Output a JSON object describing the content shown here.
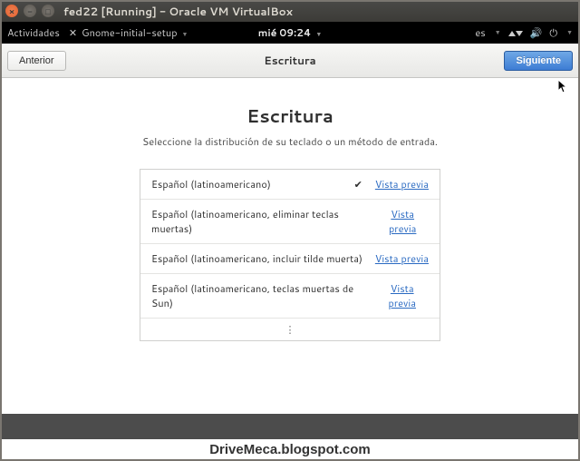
{
  "vm": {
    "title": "fed22 [Running] - Oracle VM VirtualBox"
  },
  "topbar": {
    "activities": "Actividades",
    "app": "Gnome-initial-setup",
    "clock": "mié 09:24",
    "lang": "es"
  },
  "headerbar": {
    "back": "Anterior",
    "title": "Escritura",
    "next": "Siguiente"
  },
  "page": {
    "title": "Escritura",
    "subtitle": "Seleccione la distribución de su teclado o un método de entrada."
  },
  "layouts": {
    "preview": "Vista previa",
    "items": [
      {
        "label": "Español (latinoamericano)",
        "selected": true
      },
      {
        "label": "Español (latinoamericano, eliminar teclas muertas)",
        "selected": false
      },
      {
        "label": "Español (latinoamericano, incluir tilde muerta)",
        "selected": false
      },
      {
        "label": "Español (latinoamericano, teclas muertas de Sun)",
        "selected": false
      }
    ],
    "more": "⋮"
  },
  "watermark": "DriveMeca.blogspot.com"
}
